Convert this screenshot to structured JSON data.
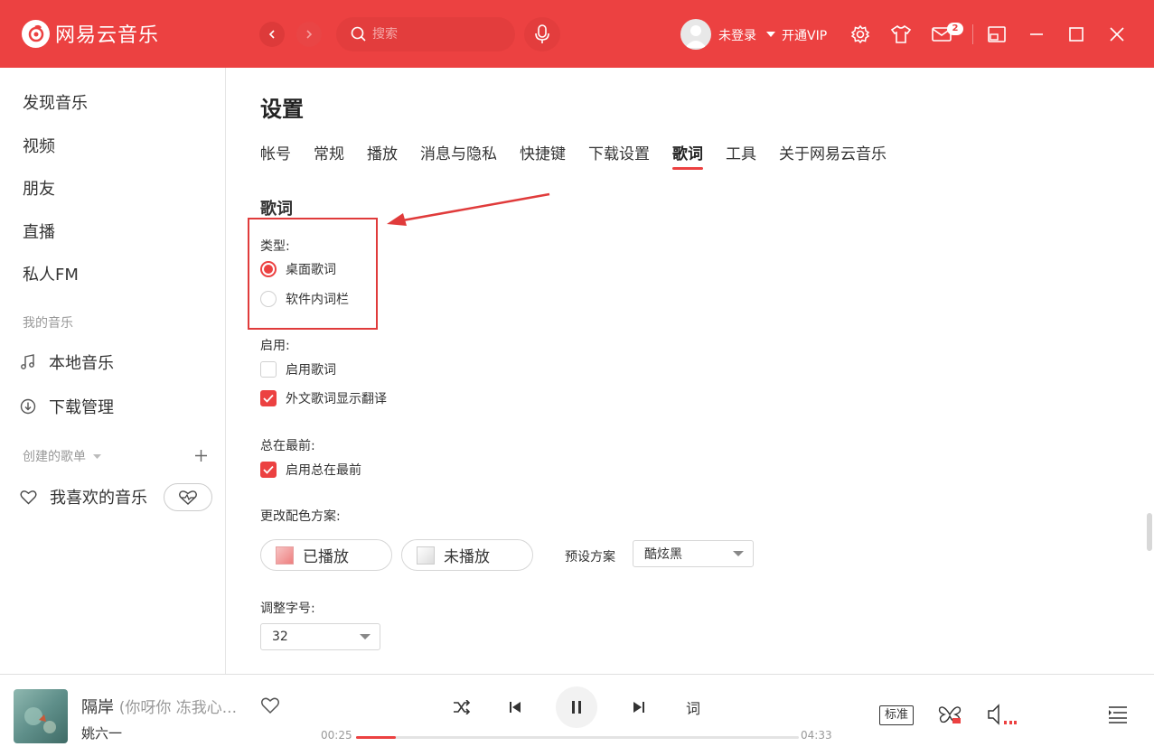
{
  "app": {
    "name": "网易云音乐"
  },
  "colors": {
    "accent": "#ec4141",
    "header_bg": "#ec4141"
  },
  "header": {
    "search_placeholder": "搜索",
    "user_label": "未登录",
    "vip_label": "开通VIP",
    "message_count": "2"
  },
  "sidebar": {
    "main_items": [
      "发现音乐",
      "视频",
      "朋友",
      "直播",
      "私人FM"
    ],
    "my_music_label": "我的音乐",
    "local_music": "本地音乐",
    "download_manager": "下载管理",
    "created_playlists_label": "创建的歌单",
    "liked_music": "我喜欢的音乐"
  },
  "settings": {
    "title": "设置",
    "tabs": [
      {
        "label": "帐号",
        "active": false
      },
      {
        "label": "常规",
        "active": false
      },
      {
        "label": "播放",
        "active": false
      },
      {
        "label": "消息与隐私",
        "active": false
      },
      {
        "label": "快捷键",
        "active": false
      },
      {
        "label": "下载设置",
        "active": false
      },
      {
        "label": "歌词",
        "active": true
      },
      {
        "label": "工具",
        "active": false
      },
      {
        "label": "关于网易云音乐",
        "active": false
      }
    ],
    "section_title": "歌词",
    "type": {
      "label": "类型:",
      "options": [
        {
          "label": "桌面歌词",
          "selected": true
        },
        {
          "label": "软件内词栏",
          "selected": false
        }
      ]
    },
    "enable": {
      "label": "启用:",
      "options": [
        {
          "label": "启用歌词",
          "checked": false
        },
        {
          "label": "外文歌词显示翻译",
          "checked": true
        }
      ]
    },
    "always_on_top": {
      "label": "总在最前:",
      "option": {
        "label": "启用总在最前",
        "checked": true
      }
    },
    "color_scheme": {
      "label": "更改配色方案:",
      "played_label": "已播放",
      "unplayed_label": "未播放",
      "preset_label": "预设方案",
      "preset_value": "酷炫黑"
    },
    "font_size": {
      "label": "调整字号:",
      "value": "32"
    }
  },
  "player": {
    "song_title": "隔岸",
    "song_subtitle": "(你呀你 冻我心...",
    "artist": "姚六一",
    "elapsed": "00:25",
    "duration": "04:33",
    "progress_fraction": 0.09,
    "lyrics_button": "词",
    "quality_label": "标准"
  }
}
